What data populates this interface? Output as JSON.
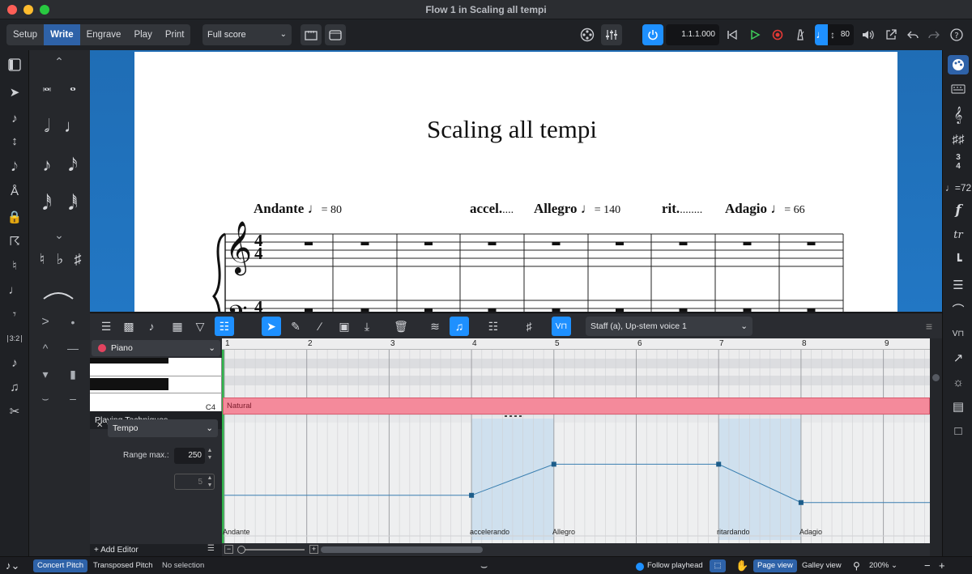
{
  "window": {
    "title": "Flow 1 in Scaling all tempi"
  },
  "toolbar": {
    "modes": [
      "Setup",
      "Write",
      "Engrave",
      "Play",
      "Print"
    ],
    "active_mode": "Write",
    "layout_select": "Full score",
    "position": "1.1.1.000",
    "tempo_value": "80"
  },
  "score": {
    "title": "Scaling all tempi",
    "tempo_marks": [
      {
        "text": "Andante",
        "note": "♩",
        "eq": "= 80"
      },
      {
        "text": "accel.",
        "dots": "....",
        "note": "",
        "eq": ""
      },
      {
        "text": "Allegro",
        "note": "♩",
        "eq": "= 140"
      },
      {
        "text": "rit.",
        "dots": "........",
        "note": "",
        "eq": ""
      },
      {
        "text": "Adagio",
        "note": "♩",
        "eq": "= 66"
      }
    ],
    "time_signature": "4/4"
  },
  "lower_zone": {
    "voice_select": "Staff (a), Up-stem voice 1"
  },
  "key_editor": {
    "instrument": "Piano",
    "key_label": "C4",
    "playing_techniques_label": "Playing Techniques",
    "technique": "Natural",
    "editor_type": "Tempo",
    "range_max_label": "Range max.:",
    "range_max_value": "250",
    "range_min_value": "5",
    "add_editor": "+ Add Editor",
    "bar_numbers": [
      "1",
      "2",
      "3",
      "4",
      "5",
      "6",
      "7",
      "8",
      "9"
    ],
    "tempo_labels": [
      "Andante",
      "accelerando",
      "Allegro",
      "ritardando",
      "Adagio"
    ]
  },
  "statusbar": {
    "concert_pitch": "Concert Pitch",
    "transposed_pitch": "Transposed Pitch",
    "selection": "No selection",
    "follow_playhead": "Follow playhead",
    "page_view": "Page view",
    "galley_view": "Galley view",
    "zoom": "200%"
  },
  "colors": {
    "accent": "#1e90ff",
    "active_tab": "#2e62a8",
    "technique_lane": "#f48a9b",
    "score_background": "#2277c4"
  }
}
